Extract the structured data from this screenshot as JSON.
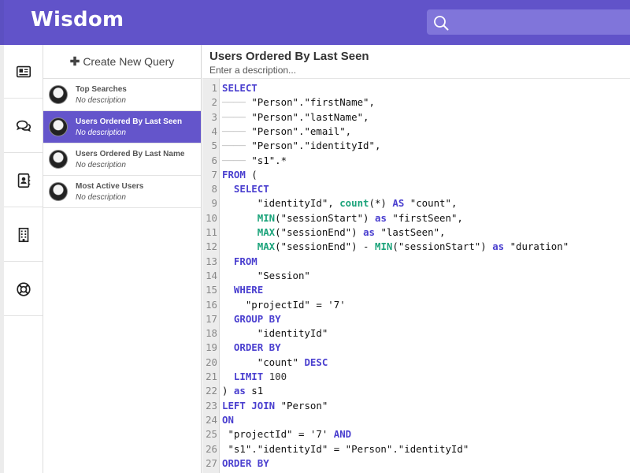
{
  "app": {
    "logo": "Wisdom",
    "search_placeholder": ""
  },
  "colors": {
    "header": "#6153c9",
    "accent": "#6455cb",
    "keyword": "#4a3fcf",
    "function": "#1aa37a"
  },
  "rail": {
    "items": [
      {
        "name": "queries",
        "icon": "newspaper-icon"
      },
      {
        "name": "conversations",
        "icon": "chat-bubbles-icon"
      },
      {
        "name": "contacts",
        "icon": "address-book-icon"
      },
      {
        "name": "companies",
        "icon": "building-icon"
      },
      {
        "name": "support",
        "icon": "lifebuoy-icon"
      }
    ]
  },
  "queries": {
    "new_label": "Create New Query",
    "items": [
      {
        "title": "Top Searches",
        "desc": "No description",
        "active": false
      },
      {
        "title": "Users Ordered By Last Seen",
        "desc": "No description",
        "active": true
      },
      {
        "title": "Users Ordered By Last Name",
        "desc": "No description",
        "active": false
      },
      {
        "title": "Most Active Users",
        "desc": "No description",
        "active": false
      }
    ]
  },
  "main": {
    "title": "Users Ordered By Last Seen",
    "desc_placeholder": "Enter a description..."
  },
  "editor": {
    "lines": [
      [
        [
          "kw",
          "SELECT"
        ]
      ],
      [
        [
          "guide",
          "──── "
        ],
        [
          "t",
          "\"Person\".\"firstName\","
        ]
      ],
      [
        [
          "guide",
          "──── "
        ],
        [
          "t",
          "\"Person\".\"lastName\","
        ]
      ],
      [
        [
          "guide",
          "──── "
        ],
        [
          "t",
          "\"Person\".\"email\","
        ]
      ],
      [
        [
          "guide",
          "──── "
        ],
        [
          "t",
          "\"Person\".\"identityId\","
        ]
      ],
      [
        [
          "guide",
          "──── "
        ],
        [
          "t",
          "\"s1\".*"
        ]
      ],
      [
        [
          "kw",
          "FROM"
        ],
        [
          "t",
          " ("
        ]
      ],
      [
        [
          "t",
          "  "
        ],
        [
          "kw",
          "SELECT"
        ]
      ],
      [
        [
          "t",
          "      \"identityId\", "
        ],
        [
          "fn",
          "count"
        ],
        [
          "t",
          "(*) "
        ],
        [
          "kw",
          "AS"
        ],
        [
          "t",
          " \"count\","
        ]
      ],
      [
        [
          "t",
          "      "
        ],
        [
          "fn",
          "MIN"
        ],
        [
          "t",
          "(\"sessionStart\") "
        ],
        [
          "kw",
          "as"
        ],
        [
          "t",
          " \"firstSeen\","
        ]
      ],
      [
        [
          "t",
          "      "
        ],
        [
          "fn",
          "MAX"
        ],
        [
          "t",
          "(\"sessionEnd\") "
        ],
        [
          "kw",
          "as"
        ],
        [
          "t",
          " \"lastSeen\","
        ]
      ],
      [
        [
          "t",
          "      "
        ],
        [
          "fn",
          "MAX"
        ],
        [
          "t",
          "(\"sessionEnd\") - "
        ],
        [
          "fn",
          "MIN"
        ],
        [
          "t",
          "(\"sessionStart\") "
        ],
        [
          "kw",
          "as"
        ],
        [
          "t",
          " \"duration\""
        ]
      ],
      [
        [
          "t",
          "  "
        ],
        [
          "kw",
          "FROM"
        ]
      ],
      [
        [
          "t",
          "      \"Session\""
        ]
      ],
      [
        [
          "t",
          "  "
        ],
        [
          "kw",
          "WHERE"
        ]
      ],
      [
        [
          "t",
          "    \"projectId\" = '7'"
        ]
      ],
      [
        [
          "t",
          "  "
        ],
        [
          "kw",
          "GROUP BY"
        ]
      ],
      [
        [
          "t",
          "      \"identityId\""
        ]
      ],
      [
        [
          "t",
          "  "
        ],
        [
          "kw",
          "ORDER BY"
        ]
      ],
      [
        [
          "t",
          "      \"count\" "
        ],
        [
          "kw",
          "DESC"
        ]
      ],
      [
        [
          "t",
          "  "
        ],
        [
          "kw",
          "LIMIT"
        ],
        [
          "num",
          " 100"
        ]
      ],
      [
        [
          "t",
          ") "
        ],
        [
          "kw",
          "as"
        ],
        [
          "t",
          " s1"
        ]
      ],
      [
        [
          "kw",
          "LEFT JOIN"
        ],
        [
          "t",
          " \"Person\""
        ]
      ],
      [
        [
          "kw",
          "ON"
        ]
      ],
      [
        [
          "t",
          " \"projectId\" = '7' "
        ],
        [
          "kw",
          "AND"
        ]
      ],
      [
        [
          "t",
          " \"s1\".\"identityId\" = \"Person\".\"identityId\""
        ]
      ],
      [
        [
          "kw",
          "ORDER BY"
        ]
      ]
    ]
  }
}
